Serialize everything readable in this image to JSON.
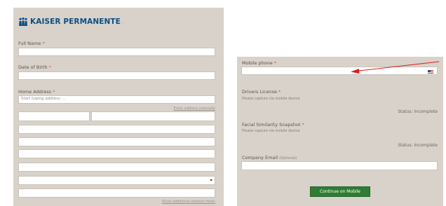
{
  "left_form": {
    "logo_text": "KAISER PERMANENTE",
    "logo_suffix": ".",
    "full_name_label": "Full Name",
    "dob_label": "Date of Birth",
    "home_address_label": "Home Address",
    "address_placeholder": "Start typing address ...",
    "enter_address_manually": "Enter address manually",
    "show_additional_fields": "Show additional address fields"
  },
  "right_form": {
    "mobile_phone_label": "Mobile phone",
    "drivers_license_label": "Drivers License",
    "drivers_license_note": "Please capture via mobile device",
    "drivers_license_status": "Status: Incomplete",
    "facial_label": "Facial Similarity Snapshot",
    "facial_note": "Please capture via mobile device",
    "facial_status": "Status: Incomplete",
    "company_email_label": "Company Email",
    "company_email_optional": "(Optional)",
    "continue_button": "Continue on Mobile"
  },
  "required_marker": "*",
  "icons": {
    "logo": "kaiser-people-icon",
    "dropdown": "chevron-down-icon",
    "flag": "us-flag-icon",
    "annotation": "red-arrow-icon"
  },
  "colors": {
    "panel_bg": "#d8d2ca",
    "brand_blue": "#0c4f84",
    "button_green": "#2e7d32",
    "annotation_red": "#e11b1b"
  }
}
